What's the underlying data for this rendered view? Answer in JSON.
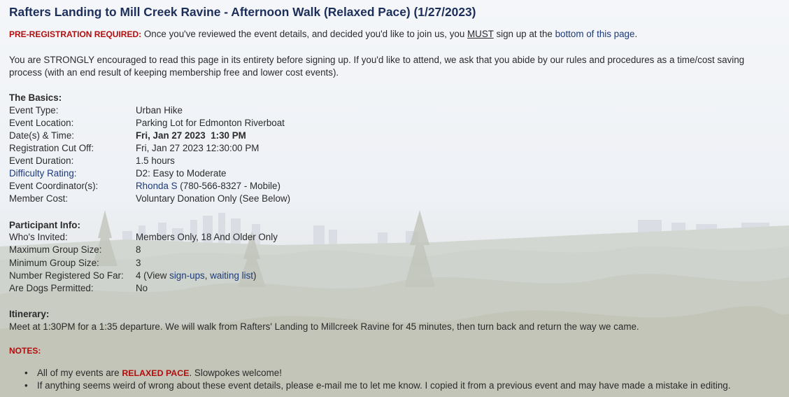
{
  "title": "Rafters Landing to Mill Creek Ravine - Afternoon Walk (Relaxed Pace) (1/27/2023)",
  "prereg": {
    "label": "PRE-REGISTRATION REQUIRED:",
    "text_before": " Once you've reviewed the event details, and decided you'd like to join us, you ",
    "must": "MUST",
    "text_middle": " sign up at the ",
    "link_text": "bottom of this page",
    "text_after": "."
  },
  "encourage_text": "You are STRONGLY encouraged to read this page in its entirety before signing up. If you'd like to attend, we ask that you abide by our rules and procedures as a time/cost saving process (with an end result of keeping membership free and lower cost events).",
  "basics": {
    "title": "The Basics:",
    "event_type": {
      "label": "Event Type:",
      "value": "Urban Hike"
    },
    "event_location": {
      "label": "Event Location:",
      "value": "Parking Lot for Edmonton Riverboat"
    },
    "date_time": {
      "label": "Date(s) & Time:",
      "value": "Fri, Jan 27 2023  1:30 PM"
    },
    "reg_cutoff": {
      "label": "Registration Cut Off:",
      "value": "Fri, Jan 27 2023 12:30:00 PM"
    },
    "duration": {
      "label": "Event Duration:",
      "value": "1.5 hours"
    },
    "difficulty": {
      "label": "Difficulty Rating:",
      "value": "D2: Easy to Moderate"
    },
    "coordinator": {
      "label": "Event Coordinator(s):",
      "name": "Rhonda S",
      "phone": " (780-566-8327 - Mobile)"
    },
    "member_cost": {
      "label": "Member Cost:",
      "value": "Voluntary Donation Only (See Below)"
    }
  },
  "participant": {
    "title": "Participant Info:",
    "whos_invited": {
      "label": "Who's Invited:",
      "value": "Members Only, 18 And Older Only"
    },
    "max_group": {
      "label": "Maximum Group Size:",
      "value": "8"
    },
    "min_group": {
      "label": "Minimum Group Size:",
      "value": "3"
    },
    "registered": {
      "label": "Number Registered So Far:",
      "count_prefix": "4 (View ",
      "signups_link": "sign-ups",
      "separator": ", ",
      "waiting_link": "waiting list",
      "suffix": ")"
    },
    "dogs": {
      "label": "Are Dogs Permitted:",
      "value": "No"
    }
  },
  "itinerary": {
    "title": "Itinerary:",
    "text": "Meet at 1:30PM for a 1:35 departure. We will walk from Rafters' Landing to Millcreek Ravine for 45 minutes, then turn back and return the way we came."
  },
  "notes": {
    "title": "NOTES:",
    "item1_before": "All of my events are ",
    "item1_relaxed": "RELAXED PACE",
    "item1_after": ". Slowpokes welcome!",
    "item2": "If anything seems weird of wrong about these event details, please e-mail me to let me know. I copied it from a previous event and may have made a mistake in editing."
  },
  "colors": {
    "title": "#1c2f5b",
    "alert_red": "#b10d0d",
    "link": "#1d3a7a"
  }
}
